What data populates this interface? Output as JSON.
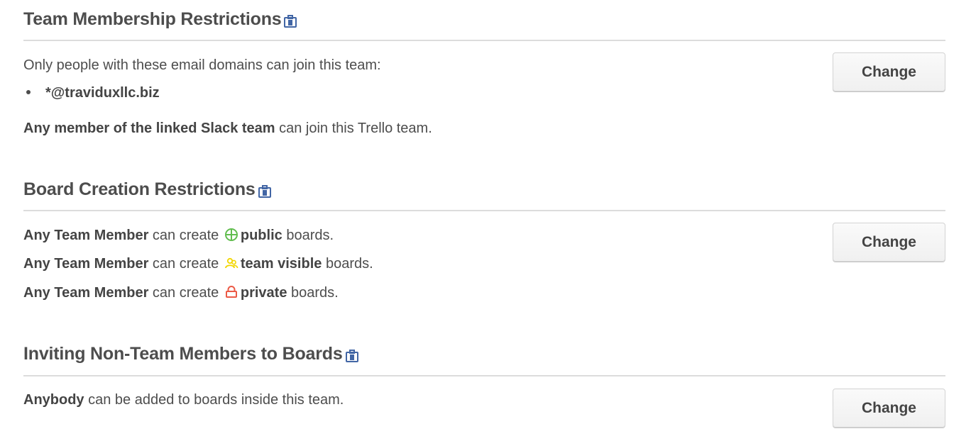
{
  "sections": {
    "membership": {
      "title": "Team Membership Restrictions",
      "badge_icon": "business-class-icon",
      "intro": "Only people with these email domains can join this team:",
      "domains": [
        "*@traviduxllc.biz"
      ],
      "slack_bold": "Any member of the linked Slack team",
      "slack_rest": " can join this Trello team.",
      "change_label": "Change"
    },
    "board_creation": {
      "title": "Board Creation Restrictions",
      "badge_icon": "business-class-icon",
      "rules": [
        {
          "who": "Any Team Member",
          "verb": " can create ",
          "visibility": "public",
          "icon": "globe-icon",
          "icon_color": "#61bd4f",
          "suffix": " boards."
        },
        {
          "who": "Any Team Member",
          "verb": " can create ",
          "visibility": "team visible",
          "icon": "team-icon",
          "icon_color": "#f2d600",
          "suffix": " boards."
        },
        {
          "who": "Any Team Member",
          "verb": " can create ",
          "visibility": "private",
          "icon": "lock-icon",
          "icon_color": "#eb5a46",
          "suffix": " boards."
        }
      ],
      "change_label": "Change"
    },
    "inviting": {
      "title": "Inviting Non-Team Members to Boards",
      "badge_icon": "business-class-icon",
      "who": "Anybody",
      "rest": " can be added to boards inside this team.",
      "change_label": "Change"
    }
  },
  "colors": {
    "business_class_badge": "#4266a5",
    "text": "#4d4d4d",
    "divider": "#dcdcdc"
  }
}
